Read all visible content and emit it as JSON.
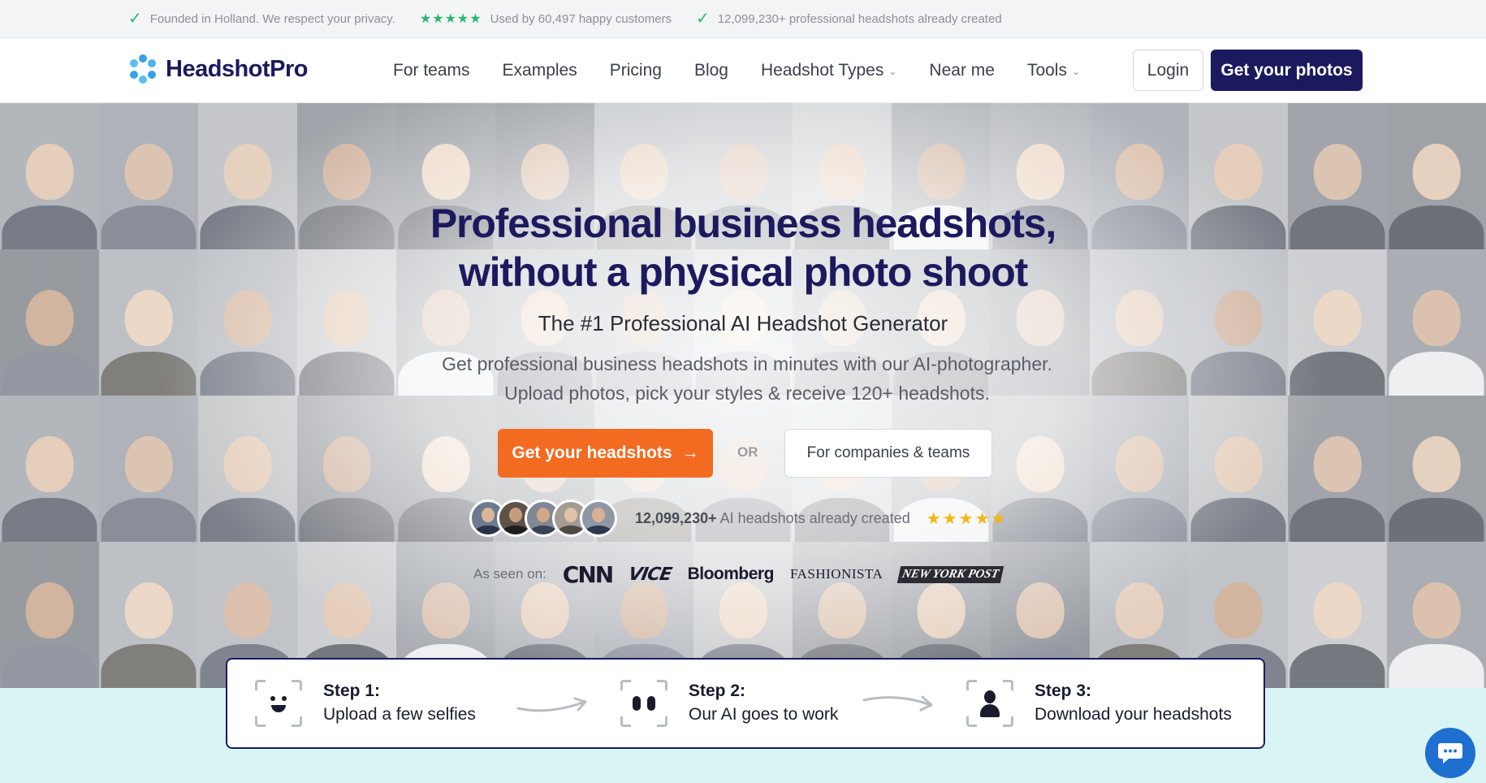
{
  "topbar": {
    "privacy": "Founded in Holland. We respect your privacy.",
    "stars": "★★★★★",
    "customers": "Used by 60,497 happy customers",
    "created": "12,099,230+ professional headshots already created"
  },
  "nav": {
    "brand": "HeadshotPro",
    "links": [
      {
        "label": "For teams",
        "dropdown": false
      },
      {
        "label": "Examples",
        "dropdown": false
      },
      {
        "label": "Pricing",
        "dropdown": false
      },
      {
        "label": "Blog",
        "dropdown": false
      },
      {
        "label": "Headshot Types",
        "dropdown": true
      },
      {
        "label": "Near me",
        "dropdown": false
      },
      {
        "label": "Tools",
        "dropdown": true
      }
    ],
    "login": "Login",
    "cta": "Get your photos"
  },
  "hero": {
    "title_line1": "Professional business headshots,",
    "title_line2": "without a physical photo shoot",
    "subtitle": "The #1 Professional AI Headshot Generator",
    "description": "Get professional business headshots in minutes with our AI-photographer. Upload photos, pick your styles & receive 120+ headshots.",
    "primary_cta": "Get your headshots",
    "or": "OR",
    "secondary_cta": "For companies & teams",
    "proof_count": "12,099,230+",
    "proof_text": " AI headshots already created",
    "proof_stars": "★★★★★",
    "seen_on": "As seen on:",
    "brands": [
      "CNN",
      "VICE",
      "Bloomberg",
      "FASHIONISTA",
      "NEW YORK POST"
    ]
  },
  "steps": [
    {
      "title": "Step 1:",
      "desc": "Upload a few selfies"
    },
    {
      "title": "Step 2:",
      "desc": "Our AI goes to work"
    },
    {
      "title": "Step 3:",
      "desc": "Download your headshots"
    }
  ],
  "colors": {
    "brand_navy": "#1c1a5e",
    "cta_orange": "#f26b21",
    "check_green": "#2bb673",
    "star_gold": "#f5b50a",
    "band_mint": "#d9f4f4",
    "chat_blue": "#1f6fd1"
  }
}
